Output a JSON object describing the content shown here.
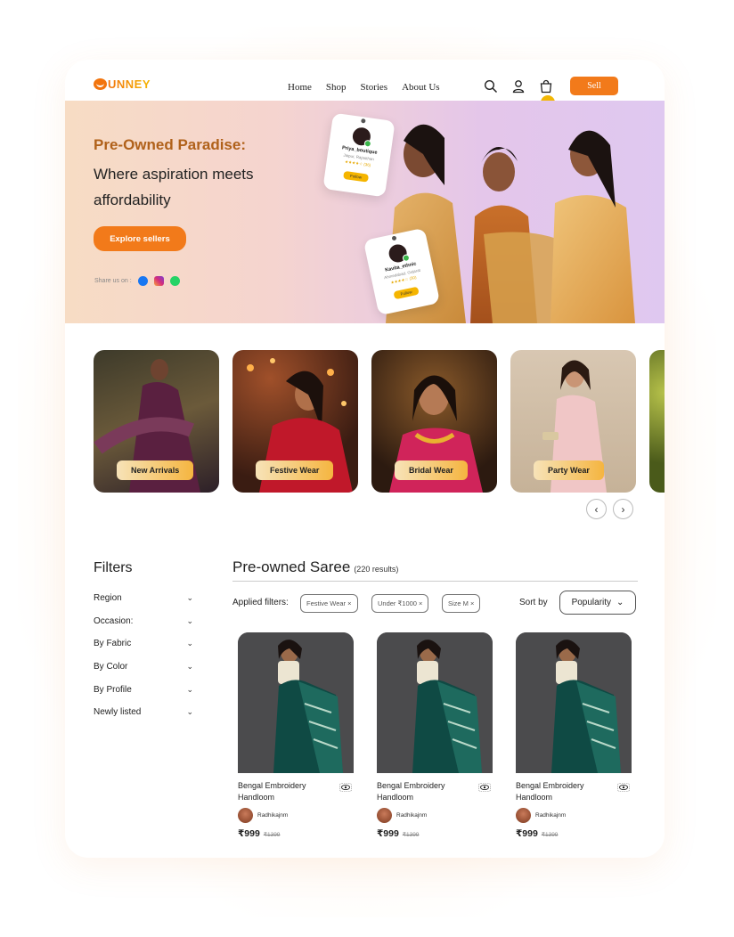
{
  "brand": {
    "name": "UNNEY"
  },
  "nav": {
    "items": [
      "Home",
      "Shop",
      "Stories",
      "About Us"
    ],
    "sell_label": "Sell"
  },
  "hero": {
    "title_accent": "Pre-Owned Paradise:",
    "title_rest": "Where aspiration meets affordability",
    "cta": "Explore sellers",
    "share_label": "Share us on :",
    "profile_cards": [
      {
        "name": "Priya_boutique",
        "location": "Jaipur, Rajasthan",
        "rating": "★★★★☆ (36)",
        "follow": "Follow"
      },
      {
        "name": "Kavita_ethnic",
        "location": "Ahmedabad, Gujarat",
        "rating": "★★★★☆ (30)",
        "follow": "Follow"
      }
    ]
  },
  "categories": [
    "New Arrivals",
    "Festive Wear",
    "Bridal Wear",
    "Party Wear"
  ],
  "filters": {
    "title": "Filters",
    "items": [
      "Region",
      "Occasion:",
      "By Fabric",
      "By Color",
      "By Profile",
      "Newly listed"
    ]
  },
  "listing": {
    "title": "Pre-owned Saree",
    "count": "(220 results)",
    "applied_label": "Applied filters:",
    "chips": [
      "Festive Wear ×",
      "Under ₹1000 ×",
      "Size M ×"
    ],
    "sort_label": "Sort by",
    "sort_value": "Popularity"
  },
  "products": [
    {
      "name": "Bengal Embroidery Handloom",
      "seller": "Radhikajnm",
      "price": "₹999",
      "old_price": "₹1399"
    },
    {
      "name": "Bengal Embroidery Handloom",
      "seller": "Radhikajnm",
      "price": "₹999",
      "old_price": "₹1399"
    },
    {
      "name": "Bengal Embroidery Handloom",
      "seller": "Radhikajnm",
      "price": "₹999",
      "old_price": "₹1399"
    }
  ],
  "colors": {
    "accent": "#f27a1a",
    "brown_title": "#b0611a",
    "gold": "#f5b500"
  }
}
